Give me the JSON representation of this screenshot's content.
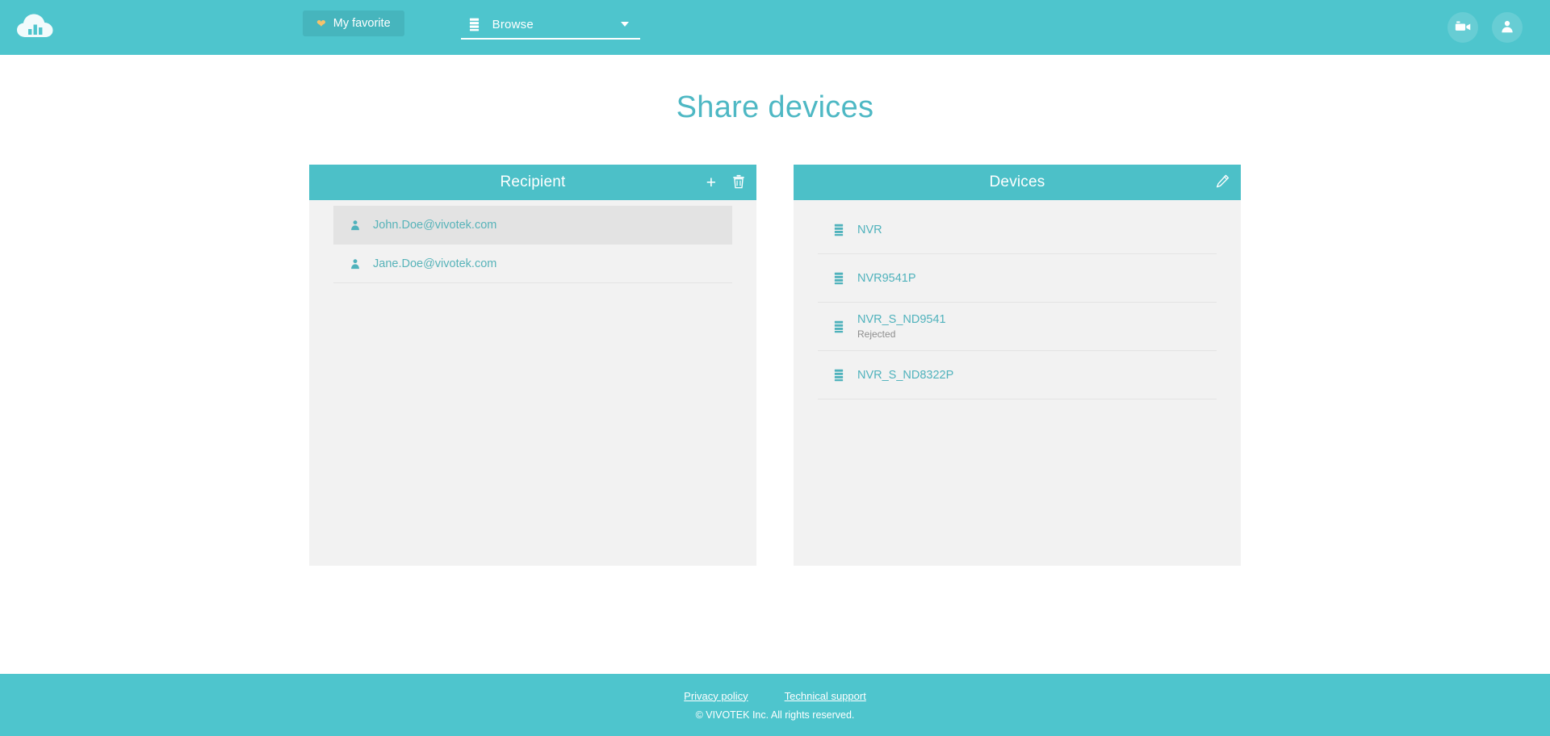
{
  "theme": {
    "teal": "#4ec5cd",
    "panel_header_teal": "#4cc0c8",
    "title_teal": "#4eb8c4",
    "link_teal": "#57b3b9",
    "panel_body_gray": "#f2f2f2",
    "selected_row_gray": "#e3e3e3",
    "heart_gold": "#f5c26b"
  },
  "topbar": {
    "logo_icon": "cloud-chart-logo",
    "favorite_button": {
      "label": "My favorite",
      "icon": "heart-icon"
    },
    "browse_dropdown": {
      "label": "Browse",
      "icon": "server-icon",
      "caret_icon": "chevron-down-icon"
    },
    "right_buttons": [
      {
        "name": "camera-button",
        "icon": "video-camera-icon"
      },
      {
        "name": "account-button",
        "icon": "user-icon"
      }
    ]
  },
  "page": {
    "title": "Share devices"
  },
  "recipient_panel": {
    "title": "Recipient",
    "actions": [
      {
        "name": "add-recipient-button",
        "icon": "plus-icon",
        "label": "+"
      },
      {
        "name": "delete-recipient-button",
        "icon": "trash-icon"
      }
    ],
    "items": [
      {
        "email": "John.Doe@vivotek.com",
        "icon": "user-icon",
        "selected": true
      },
      {
        "email": "Jane.Doe@vivotek.com",
        "icon": "user-icon",
        "selected": false
      }
    ]
  },
  "devices_panel": {
    "title": "Devices",
    "actions": [
      {
        "name": "edit-devices-button",
        "icon": "pencil-icon"
      }
    ],
    "items": [
      {
        "name": "NVR",
        "icon": "server-icon",
        "status": ""
      },
      {
        "name": "NVR9541P",
        "icon": "server-icon",
        "status": ""
      },
      {
        "name": "NVR_S_ND9541",
        "icon": "server-icon",
        "status": "Rejected"
      },
      {
        "name": "NVR_S_ND8322P",
        "icon": "server-icon",
        "status": ""
      }
    ]
  },
  "footer": {
    "links": [
      {
        "label": "Privacy policy"
      },
      {
        "label": "Technical support"
      }
    ],
    "copyright": "© VIVOTEK Inc. All rights reserved."
  }
}
